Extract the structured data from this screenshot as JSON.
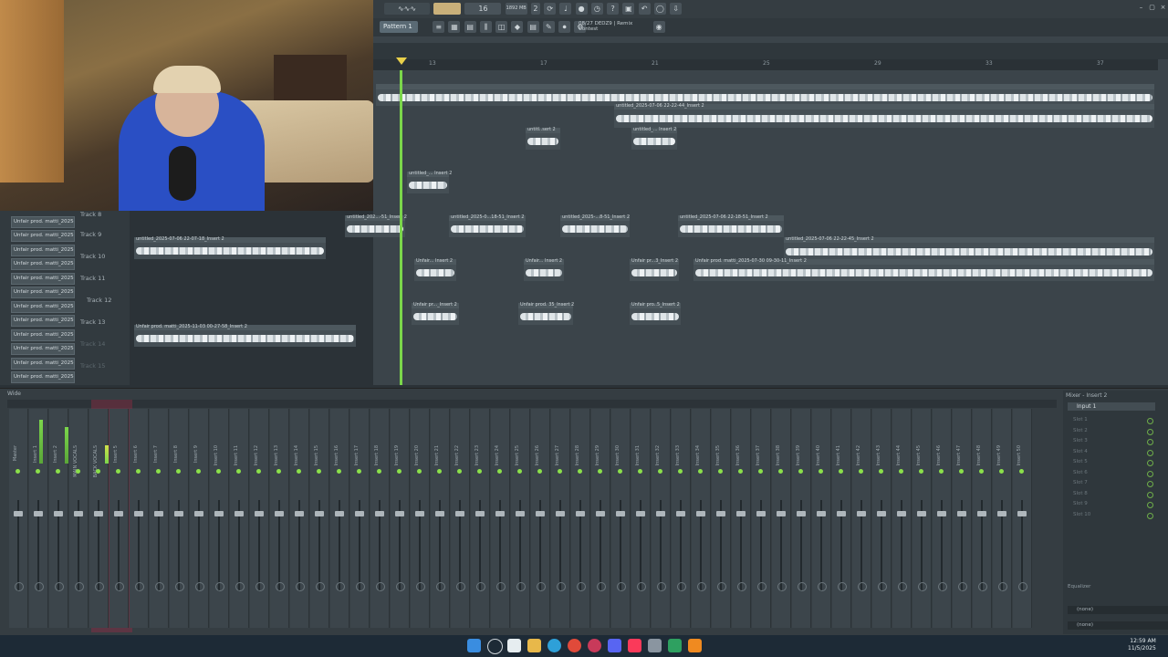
{
  "toolbar": {
    "pattern_label": "Pattern 1",
    "cpu_mem": "1892 MB",
    "cpu_top": "16",
    "cpu_bottom": "2",
    "hint_line1": "08/27 DEDZ9 | Remix",
    "hint_line2": "Contest"
  },
  "ruler": [
    "13",
    "17",
    "21",
    "25",
    "29",
    "33",
    "37"
  ],
  "tracks": [
    {
      "label": "Track 8"
    },
    {
      "label": "Track 9"
    },
    {
      "label": "Track 10"
    },
    {
      "label": "Track 11"
    },
    {
      "label": "Track 12"
    },
    {
      "label": "Track 13"
    },
    {
      "label": "Track 14"
    },
    {
      "label": "Track 15"
    }
  ],
  "side_items": [
    "Unfair prod. matti_2025-",
    "Unfair prod. matti_2025-",
    "Unfair prod. matti_2025-",
    "Unfair prod. matti_2025-",
    "Unfair prod. matti_2025-",
    "Unfair prod. matti_2025-",
    "Unfair prod. matti_2025-",
    "Unfair prod. matti_2025-",
    "Unfair prod. matti_2025-",
    "Unfair prod. matti_2025-",
    "Unfair prod. matti_2025-",
    "Unfair prod. matti_2025-"
  ],
  "clips": {
    "c1": "untitled_2025-07-06 22-22-44_Insert 2",
    "c2": "untitl..sert 2",
    "c3": "untitled_... Insert 2",
    "c4": "untitled_... Insert 2",
    "c5": "untitled_202...-51_Insert 2",
    "c6": "untitled_2025-0...18-51_Insert 2",
    "c7": "untitled_2025-...8-51_Insert 2",
    "c8": "untitled_2025-07-06 22-18-51_Insert 2",
    "c9": "untitled_2025-07-06 22-07-18_Insert 2",
    "c10": "untitled_2025-07-06 22-22-45_Insert 2",
    "c11": "Unfair... Insert 2",
    "c12": "Unfair... Insert 2",
    "c13": "Unfair pr...3_Insert 2",
    "c14": "Unfair prod. matti_2025-07-30 09-30-11_Insert 2",
    "c15": "Unfair pr..._Insert 2",
    "c16": "Unfair prod. 35_Insert 2",
    "c17": "Unfair pro..5_Insert 2",
    "c18": "Unfair prod. matti_2025-11-03 00-27-58_Insert 2"
  },
  "mixer": {
    "title": "Wide",
    "strips": [
      "Master",
      "Insert 1",
      "Insert 2",
      "MAIN VOCALS",
      "BACK VOCALS",
      "Insert 5",
      "Insert 6",
      "Insert 7",
      "Insert 8",
      "Insert 9",
      "Insert 10",
      "Insert 11",
      "Insert 12",
      "Insert 13",
      "Insert 14",
      "Insert 15",
      "Insert 16",
      "Insert 17",
      "Insert 18",
      "Insert 19",
      "Insert 20",
      "Insert 21",
      "Insert 22",
      "Insert 23",
      "Insert 24",
      "Insert 25",
      "Insert 26",
      "Insert 27",
      "Insert 28",
      "Insert 29",
      "Insert 30",
      "Insert 31",
      "Insert 32",
      "Insert 33",
      "Insert 34",
      "Insert 35",
      "Insert 36",
      "Insert 37",
      "Insert 38",
      "Insert 39",
      "Insert 40",
      "Insert 41",
      "Insert 42",
      "Insert 43",
      "Insert 44",
      "Insert 45",
      "Insert 46",
      "Insert 47",
      "Insert 48",
      "Insert 49",
      "Insert 50"
    ]
  },
  "insert_panel": {
    "title": "Mixer - Insert 2",
    "input": "Input 1",
    "slots": [
      "Slot 1",
      "Slot 2",
      "Slot 3",
      "Slot 4",
      "Slot 5",
      "Slot 6",
      "Slot 7",
      "Slot 8",
      "Slot 9",
      "Slot 10"
    ],
    "eq_label": "Equalizer",
    "none1": "(none)",
    "none2": "(none)"
  },
  "taskbar": {
    "time": "12:59 AM",
    "date": "11/5/2025"
  },
  "colors": {
    "accent": "#7bd64b",
    "playhead_marker": "#e9d04a",
    "vocal_highlight": "#aa2846"
  }
}
